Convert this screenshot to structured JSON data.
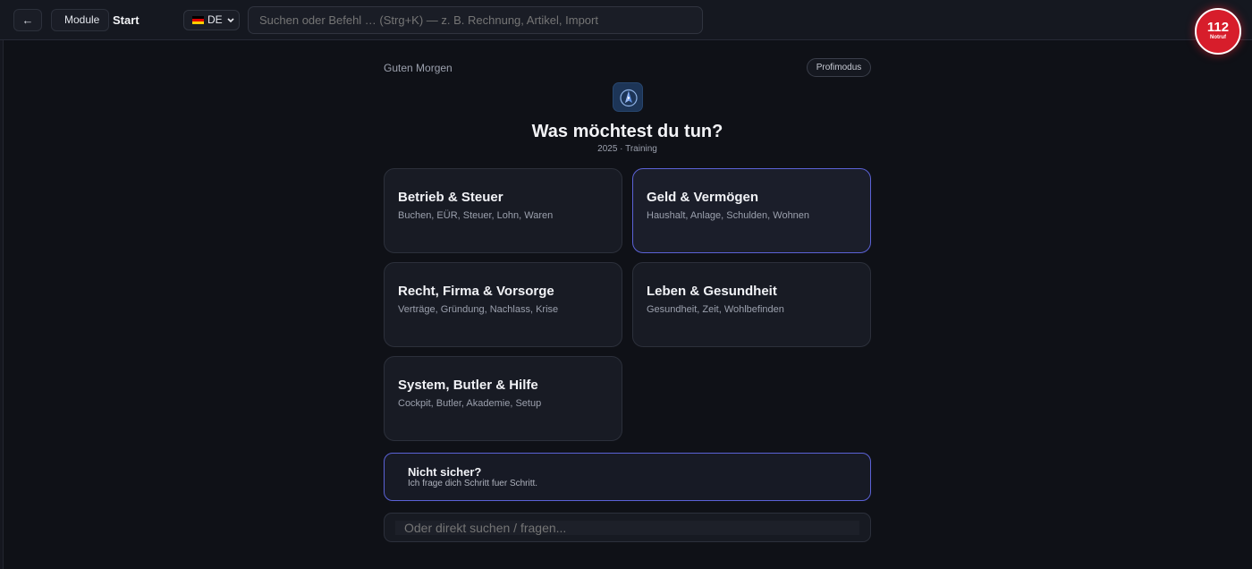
{
  "topbar": {
    "back_label": "←",
    "module_label": "Module",
    "breadcrumb": "Start",
    "language": "DE",
    "search_placeholder": "Suchen oder Befehl … (Strg+K) — z. B. Rechnung, Artikel, Import",
    "emergency_number": "112",
    "emergency_label": "Notruf"
  },
  "main": {
    "greeting": "Guten Morgen",
    "pro_mode_label": "Profimodus",
    "heading": "Was möchtest du tun?",
    "subheading": "2025 · Training",
    "cards": [
      {
        "title": "Betrieb & Steuer",
        "subtitle": "Buchen, EÜR, Steuer, Lohn, Waren"
      },
      {
        "title": "Geld & Vermögen",
        "subtitle": "Haushalt, Anlage, Schulden, Wohnen"
      },
      {
        "title": "Recht, Firma & Vorsorge",
        "subtitle": "Verträge, Gründung, Nachlass, Krise"
      },
      {
        "title": "Leben & Gesundheit",
        "subtitle": "Gesundheit, Zeit, Wohlbefinden"
      },
      {
        "title": "System, Butler & Hilfe",
        "subtitle": "Cockpit, Butler, Akademie, Setup"
      }
    ],
    "unsure": {
      "title": "Nicht sicher?",
      "subtitle": "Ich frage dich Schritt fuer Schritt."
    },
    "ask_placeholder": "Oder direkt suchen / fragen..."
  },
  "colors": {
    "background": "#0f1117",
    "accent": "#5b62d6",
    "emergency": "#d71d2b"
  },
  "icons": {
    "back": "arrow-left-icon",
    "language_flag": "german-flag-icon",
    "dropdown": "chevron-down-icon",
    "logo": "compass-icon"
  }
}
